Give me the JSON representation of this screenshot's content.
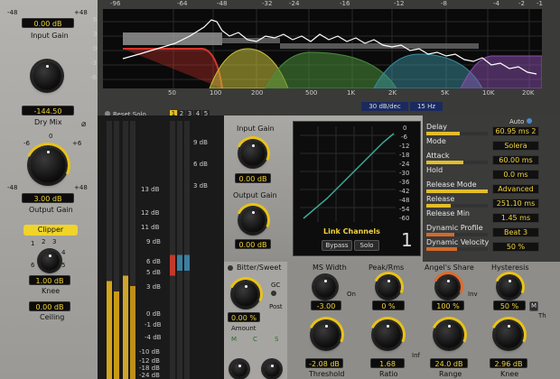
{
  "left": {
    "input_gain_value": "0.00 dB",
    "input_gain_label": "Input Gain",
    "input_min": "-48",
    "input_max": "+48",
    "dry_mix_value": "-144.50",
    "dry_mix_label": "Dry Mix",
    "output_gain_value": "3.00 dB",
    "output_gain_label": "Output Gain",
    "out_scale": [
      "-6",
      "0",
      "+6"
    ],
    "out_min": "-48",
    "out_max": "+48",
    "clipper_label": "Clipper",
    "knee_value": "1.00 dB",
    "knee_label": "Knee",
    "knee_scale": [
      "1",
      "2",
      "3",
      "4",
      "5",
      "6"
    ],
    "ceiling_value": "0.00 dB",
    "ceiling_label": "Ceiling"
  },
  "spectrum": {
    "db_ticks": [
      "-96",
      "-64",
      "-48",
      "-32",
      "-24",
      "-16",
      "-12",
      "-8",
      "-4",
      "-2",
      "-1"
    ],
    "y_labels": [
      "6",
      "3",
      "0",
      "-3",
      "-6"
    ],
    "freq_labels": [
      "50",
      "100",
      "200",
      "500",
      "1K",
      "2K",
      "5K",
      "10K",
      "20K"
    ],
    "reset_solo": "Reset Solo",
    "bands": [
      "1",
      "2",
      "3",
      "4",
      "5"
    ],
    "slope": "30 dB/dec",
    "freq_readout": "15 Hz",
    "band_colors": [
      "#d8342a",
      "#c9c13a",
      "#4a8f3c",
      "#3a8fa0",
      "#2a6fb0",
      "#8a4fb0"
    ]
  },
  "meter": {
    "scale": [
      "13 dB",
      "12 dB",
      "11 dB",
      "9 dB",
      "6 dB",
      "5 dB",
      "3 dB",
      "0 dB",
      "-1 dB",
      "-4 dB",
      "-10 dB",
      "-12 dB",
      "-18 dB",
      "-24 dB"
    ],
    "top_scale": [
      "9 dB",
      "6 dB",
      "3 dB"
    ]
  },
  "band_panel": {
    "input_gain_label": "Input Gain",
    "input_gain_value": "0.00 dB",
    "output_gain_label": "Output Gain",
    "output_gain_value": "0.00 dB",
    "link_channels": "Link Channels",
    "bypass": "Bypass",
    "solo": "Solo",
    "band_number": "1",
    "curve_ticks": [
      "0",
      "-6",
      "-12",
      "-18",
      "-24",
      "-30",
      "-36",
      "-42",
      "-48",
      "-54",
      "-60"
    ]
  },
  "params": {
    "auto": "Auto",
    "delay_label": "Delay",
    "delay_value": "60.95 ms 2",
    "mode_label": "Mode",
    "mode_value": "Solera",
    "attack_label": "Attack",
    "attack_value": "60.00 ms",
    "hold_label": "Hold",
    "hold_value": "0.0 ms",
    "release_mode_label": "Release Mode",
    "release_mode_value": "Advanced",
    "release_label": "Release",
    "release_value": "251.10 ms",
    "release_min_label": "Release Min",
    "release_min_value": "1.45 ms",
    "dyn_profile_label": "Dynamic Profile",
    "dyn_profile_value": "Beat 3",
    "dyn_velocity_label": "Dynamic Velocity",
    "dyn_velocity_value": "50 %"
  },
  "bottom": {
    "bitter_label": "Bitter/Sweet",
    "bitter_value": "0.00 %",
    "gc": "GC",
    "post": "Post",
    "amount_label": "Amount",
    "msc": [
      "M",
      "C",
      "S"
    ],
    "ms_width_label": "MS Width",
    "ms_width_value": "-3.00",
    "on": "On",
    "peak_rms_label": "Peak/Rms",
    "peak_rms_value": "0 %",
    "angels_share_label": "Angel's Share",
    "angels_share_value": "100 %",
    "inv": "Inv",
    "hysteresis_label": "Hysteresis",
    "hysteresis_value": "50 %",
    "threshold_label": "Threshold",
    "threshold_value": "-2.08 dB",
    "ratio_label": "Ratio",
    "ratio_value": "1.68",
    "inf": "Inf",
    "range_label": "Range",
    "range_value": "24.0 dB",
    "knee_label": "Knee",
    "knee_value": "2.96 dB",
    "th": "Th",
    "m": "M"
  }
}
